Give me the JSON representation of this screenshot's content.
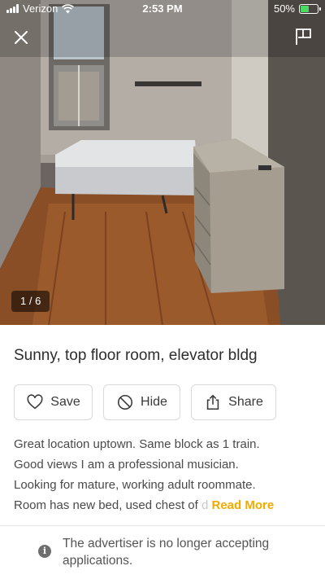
{
  "status_bar": {
    "carrier": "Verizon",
    "time": "2:53 PM",
    "battery_percent": "50%",
    "battery_level": 0.5
  },
  "photo": {
    "counter": "1 / 6"
  },
  "listing": {
    "title": "Sunny, top floor room, elevator bldg",
    "description_lines": [
      "Great location uptown. Same block as 1 train.",
      "Good views I am a professional musician.",
      "Looking for mature, working adult roommate.",
      "Room has new bed, used chest of"
    ],
    "description_fade": "d",
    "read_more": "Read More"
  },
  "actions": {
    "save": "Save",
    "hide": "Hide",
    "share": "Share"
  },
  "notice": {
    "text": "The advertiser is no longer accepting applications."
  },
  "colors": {
    "accent": "#f2a900",
    "battery": "#4cd964"
  },
  "icons": [
    "wifi-icon",
    "battery-icon",
    "close-icon",
    "flag-icon",
    "heart-icon",
    "hide-icon",
    "share-icon",
    "info-icon"
  ]
}
